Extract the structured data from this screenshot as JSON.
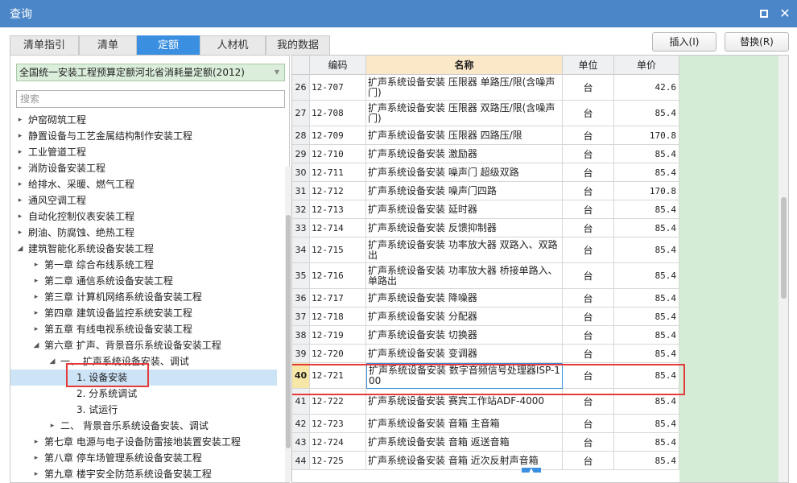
{
  "window": {
    "title": "查询"
  },
  "tabs": [
    {
      "label": "清单指引"
    },
    {
      "label": "清单"
    },
    {
      "label": "定额"
    },
    {
      "label": "人材机"
    },
    {
      "label": "我的数据"
    }
  ],
  "actions": {
    "insert_label": "插入(I)",
    "replace_label": "替换(R)"
  },
  "library": {
    "selected": "全国统一安装工程预算定额河北省消耗量定额(2012)"
  },
  "search": {
    "placeholder": "搜索"
  },
  "tree": [
    {
      "label": "炉窑砌筑工程",
      "expanded": false,
      "level": 0
    },
    {
      "label": "静置设备与工艺金属结构制作安装工程",
      "expanded": false,
      "level": 0
    },
    {
      "label": "工业管道工程",
      "expanded": false,
      "level": 0
    },
    {
      "label": "消防设备安装工程",
      "expanded": false,
      "level": 0
    },
    {
      "label": "给排水、采暖、燃气工程",
      "expanded": false,
      "level": 0
    },
    {
      "label": "通风空调工程",
      "expanded": false,
      "level": 0
    },
    {
      "label": "自动化控制仪表安装工程",
      "expanded": false,
      "level": 0
    },
    {
      "label": "刷油、防腐蚀、绝热工程",
      "expanded": false,
      "level": 0
    },
    {
      "label": "建筑智能化系统设备安装工程",
      "expanded": true,
      "level": 0
    },
    {
      "label": "第一章 综合布线系统工程",
      "expanded": false,
      "level": 1
    },
    {
      "label": "第二章 通信系统设备安装工程",
      "expanded": false,
      "level": 1
    },
    {
      "label": "第三章 计算机网络系统设备安装工程",
      "expanded": false,
      "level": 1
    },
    {
      "label": "第四章 建筑设备监控系统安装工程",
      "expanded": false,
      "level": 1
    },
    {
      "label": "第五章 有线电视系统设备安装工程",
      "expanded": false,
      "level": 1
    },
    {
      "label": "第六章 扩声、背景音乐系统设备安装工程",
      "expanded": true,
      "level": 1
    },
    {
      "label": "一、 扩声系统设备安装、调试",
      "expanded": true,
      "level": 2
    },
    {
      "label": "1. 设备安装",
      "expanded": null,
      "level": 3,
      "selected": true
    },
    {
      "label": "2. 分系统调试",
      "expanded": null,
      "level": 3
    },
    {
      "label": "3. 试运行",
      "expanded": null,
      "level": 3
    },
    {
      "label": "二、 背景音乐系统设备安装、调试",
      "expanded": false,
      "level": 2
    },
    {
      "label": "第七章 电源与电子设备防雷接地装置安装工程",
      "expanded": false,
      "level": 1
    },
    {
      "label": "第八章 停车场管理系统设备安装工程",
      "expanded": false,
      "level": 1
    },
    {
      "label": "第九章 楼宇安全防范系统设备安装工程",
      "expanded": false,
      "level": 1
    }
  ],
  "table": {
    "headers": {
      "code": "编码",
      "name": "名称",
      "unit": "单位",
      "price": "单价"
    },
    "rows": [
      {
        "num": "26",
        "code": "12-707",
        "name": "扩声系统设备安装 压限器 单路压/限(含噪声门)",
        "unit": "台",
        "price": "42.6"
      },
      {
        "num": "27",
        "code": "12-708",
        "name": "扩声系统设备安装 压限器 双路压/限(含噪声门)",
        "unit": "台",
        "price": "85.4"
      },
      {
        "num": "28",
        "code": "12-709",
        "name": "扩声系统设备安装 压限器 四路压/限",
        "unit": "台",
        "price": "170.8"
      },
      {
        "num": "29",
        "code": "12-710",
        "name": "扩声系统设备安装 激励器",
        "unit": "台",
        "price": "85.4"
      },
      {
        "num": "30",
        "code": "12-711",
        "name": "扩声系统设备安装 噪声门 超级双路",
        "unit": "台",
        "price": "85.4"
      },
      {
        "num": "31",
        "code": "12-712",
        "name": "扩声系统设备安装 噪声门四路",
        "unit": "台",
        "price": "170.8"
      },
      {
        "num": "32",
        "code": "12-713",
        "name": "扩声系统设备安装 延时器",
        "unit": "台",
        "price": "85.4"
      },
      {
        "num": "33",
        "code": "12-714",
        "name": "扩声系统设备安装 反馈抑制器",
        "unit": "台",
        "price": "85.4"
      },
      {
        "num": "34",
        "code": "12-715",
        "name": "扩声系统设备安装 功率放大器 双路入、双路出",
        "unit": "台",
        "price": "85.4"
      },
      {
        "num": "35",
        "code": "12-716",
        "name": "扩声系统设备安装 功率放大器 桥接单路入、单路出",
        "unit": "台",
        "price": "85.4"
      },
      {
        "num": "36",
        "code": "12-717",
        "name": "扩声系统设备安装 降噪器",
        "unit": "台",
        "price": "85.4"
      },
      {
        "num": "37",
        "code": "12-718",
        "name": "扩声系统设备安装 分配器",
        "unit": "台",
        "price": "85.4"
      },
      {
        "num": "38",
        "code": "12-719",
        "name": "扩声系统设备安装 切换器",
        "unit": "台",
        "price": "85.4"
      },
      {
        "num": "39",
        "code": "12-720",
        "name": "扩声系统设备安装 变调器",
        "unit": "台",
        "price": "85.4"
      },
      {
        "num": "40",
        "code": "12-721",
        "name": "扩声系统设备安装 数字音频信号处理器ISP-100",
        "unit": "台",
        "price": "85.4",
        "selected": true
      },
      {
        "num": "41",
        "code": "12-722",
        "name": "扩声系统设备安装 赛宾工作站ADF-4000",
        "unit": "台",
        "price": "85.4"
      },
      {
        "num": "42",
        "code": "12-723",
        "name": "扩声系统设备安装 音箱 主音箱",
        "unit": "台",
        "price": "85.4"
      },
      {
        "num": "43",
        "code": "12-724",
        "name": "扩声系统设备安装 音箱 返送音箱",
        "unit": "台",
        "price": "85.4"
      },
      {
        "num": "44",
        "code": "12-725",
        "name": "扩声系统设备安装 音箱 近次反射声音箱",
        "unit": "台",
        "price": "85.4"
      }
    ]
  },
  "icons": {
    "maximize": "maximize-icon",
    "close": "close-icon",
    "tree_collapsed": "chevron-right-icon",
    "tree_expanded": "chevron-down-icon",
    "dropdown": "chevron-down-icon"
  },
  "colors": {
    "titlebar": "#4a86c8",
    "active_tab": "#3a8fe0",
    "library_bg": "#dbeedb",
    "name_header": "#fbe8c8",
    "green_fill": "#d4ebd5",
    "selection": "#cde4f7",
    "highlight_box": "#e43a3a"
  }
}
